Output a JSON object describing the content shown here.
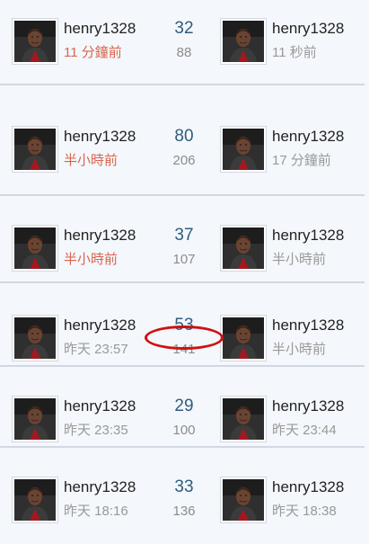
{
  "rows": [
    {
      "left": {
        "name": "henry1328",
        "time": "11 分鐘前",
        "time_style": "recent"
      },
      "counts": {
        "big": "32",
        "small": "88"
      },
      "right": {
        "name": "henry1328",
        "time": "11 秒前",
        "time_style": "old"
      }
    },
    {
      "left": {
        "name": "henry1328",
        "time": "半小時前",
        "time_style": "recent"
      },
      "counts": {
        "big": "80",
        "small": "206"
      },
      "right": {
        "name": "henry1328",
        "time": "17 分鐘前",
        "time_style": "old"
      }
    },
    {
      "left": {
        "name": "henry1328",
        "time": "半小時前",
        "time_style": "recent"
      },
      "counts": {
        "big": "37",
        "small": "107"
      },
      "right": {
        "name": "henry1328",
        "time": "半小時前",
        "time_style": "old"
      }
    },
    {
      "left": {
        "name": "henry1328",
        "time": "昨天 23:57",
        "time_style": "old"
      },
      "counts": {
        "big": "53",
        "small": "141"
      },
      "right": {
        "name": "henry1328",
        "time": "半小時前",
        "time_style": "old"
      }
    },
    {
      "left": {
        "name": "henry1328",
        "time": "昨天 23:35",
        "time_style": "old"
      },
      "counts": {
        "big": "29",
        "small": "100"
      },
      "right": {
        "name": "henry1328",
        "time": "昨天 23:44",
        "time_style": "old"
      }
    },
    {
      "left": {
        "name": "henry1328",
        "time": "昨天 18:16",
        "time_style": "old"
      },
      "counts": {
        "big": "33",
        "small": "136"
      },
      "right": {
        "name": "henry1328",
        "time": "昨天 18:38",
        "time_style": "old"
      }
    }
  ],
  "icons": {
    "avatar": "user-avatar-icon",
    "highlight": "red-circle-highlight"
  },
  "colors": {
    "recent_time": "#d8654e",
    "old_time": "#999999",
    "count_big": "#2f5d80",
    "highlight": "#d01010"
  },
  "highlight": {
    "row": 3,
    "target": "counts.small"
  }
}
